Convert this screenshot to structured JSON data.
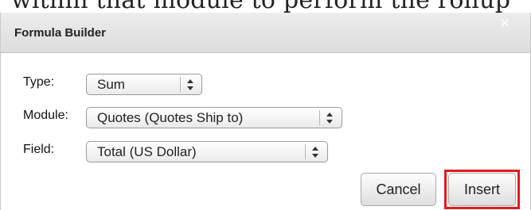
{
  "background_text": "within that module to perform the rollup",
  "dialog": {
    "title": "Formula Builder",
    "close_label": "×"
  },
  "form": {
    "type": {
      "label": "Type:",
      "value": "Sum"
    },
    "module": {
      "label": "Module:",
      "value": "Quotes (Quotes Ship to)"
    },
    "field": {
      "label": "Field:",
      "value": "Total (US Dollar)"
    }
  },
  "buttons": {
    "cancel_label": "Cancel",
    "insert_label": "Insert"
  },
  "colors": {
    "highlight": "#e01b1b"
  },
  "icons": {
    "close": "close-icon",
    "select_arrows": "updown-arrows-icon"
  }
}
